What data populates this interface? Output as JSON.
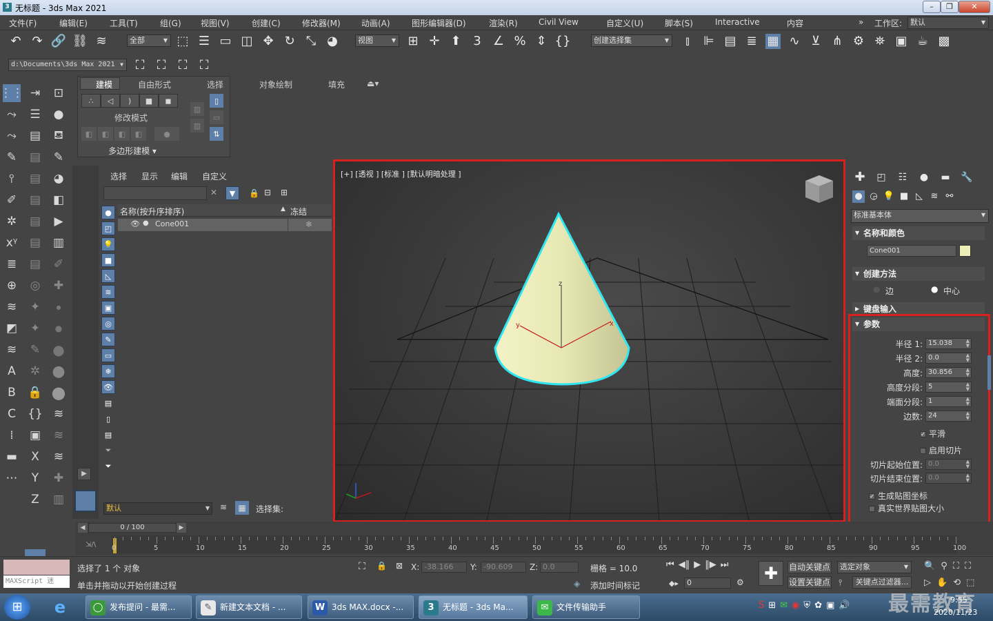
{
  "window": {
    "title": "无标题 - 3ds Max 2021",
    "app_icon": "3",
    "workspace_label": "工作区:",
    "workspace_value": "默认"
  },
  "menu": [
    "文件(F)",
    "编辑(E)",
    "工具(T)",
    "组(G)",
    "视图(V)",
    "创建(C)",
    "修改器(M)",
    "动画(A)",
    "图形编辑器(D)",
    "渲染(R)",
    "Civil View",
    "自定义(U)",
    "脚本(S)",
    "Interactive",
    "内容"
  ],
  "toolbar": {
    "filter_dropdown": "全部",
    "ref_coord_dropdown": "视图",
    "selection_set_dropdown": "创建选择集",
    "path": "d:\\Documents\\3ds Max 2021"
  },
  "ribbon": {
    "tabs": [
      "建模",
      "自由形式",
      "选择",
      "对象绘制",
      "填充"
    ],
    "group_label": "修改模式",
    "footer": "多边形建模"
  },
  "scene_explorer": {
    "menu": [
      "选择",
      "显示",
      "编辑",
      "自定义"
    ],
    "col_name": "名称(按升序排序)",
    "col_freeze": "冻结",
    "items": [
      {
        "name": "Cone001"
      }
    ],
    "layer_dropdown": "默认",
    "selection_set_label": "选择集:"
  },
  "viewport": {
    "label": "[+] [透视 ] [标准 ] [默认明暗处理 ]",
    "axes": {
      "x": "x",
      "y": "y",
      "z": "z"
    }
  },
  "command_panel": {
    "category_dropdown": "标准基本体",
    "rollouts": {
      "name_color": "名称和颜色",
      "creation_method": "创建方法",
      "keyboard_entry": "键盘输入",
      "parameters": "参数"
    },
    "object_name": "Cone001",
    "object_color": "#eeeeb8",
    "creation_options": [
      "边",
      "中心"
    ],
    "params": [
      {
        "label": "半径 1:",
        "value": "15.038"
      },
      {
        "label": "半径 2:",
        "value": "0.0"
      },
      {
        "label": "高度:",
        "value": "30.856"
      },
      {
        "label": "高度分段:",
        "value": "5"
      },
      {
        "label": "端面分段:",
        "value": "1"
      },
      {
        "label": "边数:",
        "value": "24"
      }
    ],
    "smooth": "平滑",
    "slice_on": "启用切片",
    "slice_from": {
      "label": "切片起始位置:",
      "value": "0.0"
    },
    "slice_to": {
      "label": "切片结束位置:",
      "value": "0.0"
    },
    "gen_mapping": "生成贴图坐标",
    "real_world": "真实世界贴图大小"
  },
  "timeline": {
    "frame": "0 / 100",
    "ticks": [
      "0",
      "5",
      "10",
      "15",
      "20",
      "25",
      "30",
      "35",
      "40",
      "45",
      "50",
      "55",
      "60",
      "65",
      "70",
      "75",
      "80",
      "85",
      "90",
      "95",
      "100"
    ]
  },
  "status": {
    "maxscript": "MAXScript 迷",
    "selected": "选择了 1 个 对象",
    "hint": "单击并拖动以开始创建过程",
    "x_label": "X:",
    "x": "-38.166",
    "y_label": "Y:",
    "y": "-90.609",
    "z_label": "Z:",
    "z": "0.0",
    "grid": "栅格 = 10.0",
    "add_time_tag": "添加时间标记",
    "auto_key": "自动关键点",
    "set_key": "设置关键点",
    "selected_obj": "选定对象",
    "key_filter": "关键点过滤器...",
    "frame_field": "0"
  },
  "taskbar": {
    "tasks": [
      "发布提问 - 最需...",
      "新建文本文档 - ...",
      "3ds MAX.docx -...",
      "无标题 - 3ds Ma...",
      "文件传输助手"
    ],
    "time": "9:55",
    "date": "2020/11/23",
    "watermark": "最需教育"
  }
}
